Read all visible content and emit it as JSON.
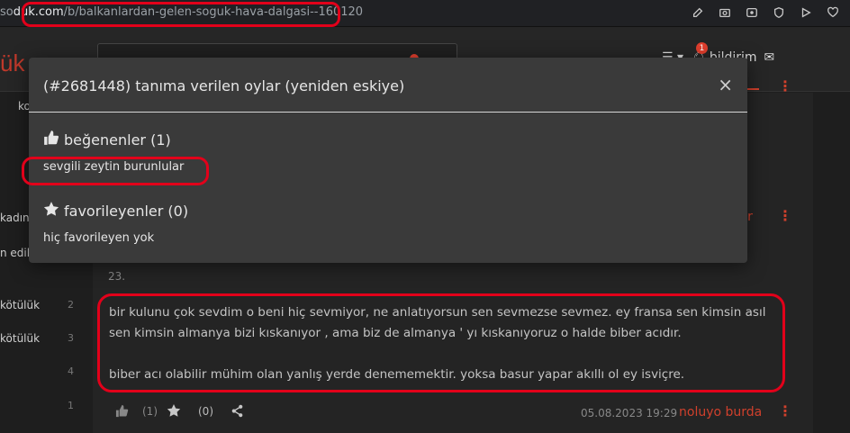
{
  "browser": {
    "url_prefix": "so",
    "url_domain": "duk.com",
    "url_path": "/b/balkanlardan-gelen-soguk-hava-dalgasi--160120"
  },
  "header": {
    "logo_fragment": "ük",
    "notifications_label": "bildirim",
    "notification_count": "1"
  },
  "sidebar": {
    "items": [
      {
        "label": "ko",
        "count": ""
      },
      {
        "label": "kadın",
        "count": ""
      },
      {
        "label": "n edile",
        "count": ""
      },
      {
        "label": "kötülük",
        "count": "2"
      },
      {
        "label": "kötülük",
        "count": "3"
      },
      {
        "label": "",
        "count": "4"
      },
      {
        "label": "",
        "count": "1"
      }
    ]
  },
  "modal": {
    "title": "(#2681448) tanıma verilen oylar (yeniden eskiye)",
    "close_label": "×",
    "likes_heading": "beğenenler (1)",
    "likes_user": "sevgili zeytin burunlular",
    "favorites_heading": "favorileyenler (0)",
    "favorites_empty": "hiç favorileyen yok"
  },
  "entry": {
    "partial_author_fragment": "kr",
    "number": "23.",
    "paragraph_1": "bir kulunu çok sevdim o beni hiç sevmiyor, ne anlatıyorsun sen sevmezse sevmez. ey fransa sen kimsin asıl sen kimsin almanya bizi kıskanıyor , ama biz de almanya ' yı kıskanıyoruz o halde biber acıdır.",
    "paragraph_2": "biber acı olabilir mühim olan yanlış yerde denememektir. yoksa basur yapar akıllı ol ey isviçre.",
    "like_count": "(1)",
    "favorite_count": "(0)",
    "date": "05.08.2023 19:29",
    "author": "noluyo burda"
  },
  "colors": {
    "accent": "#d0402c",
    "annotation": "#e2001a",
    "modal_bg": "#3a3a3a"
  }
}
